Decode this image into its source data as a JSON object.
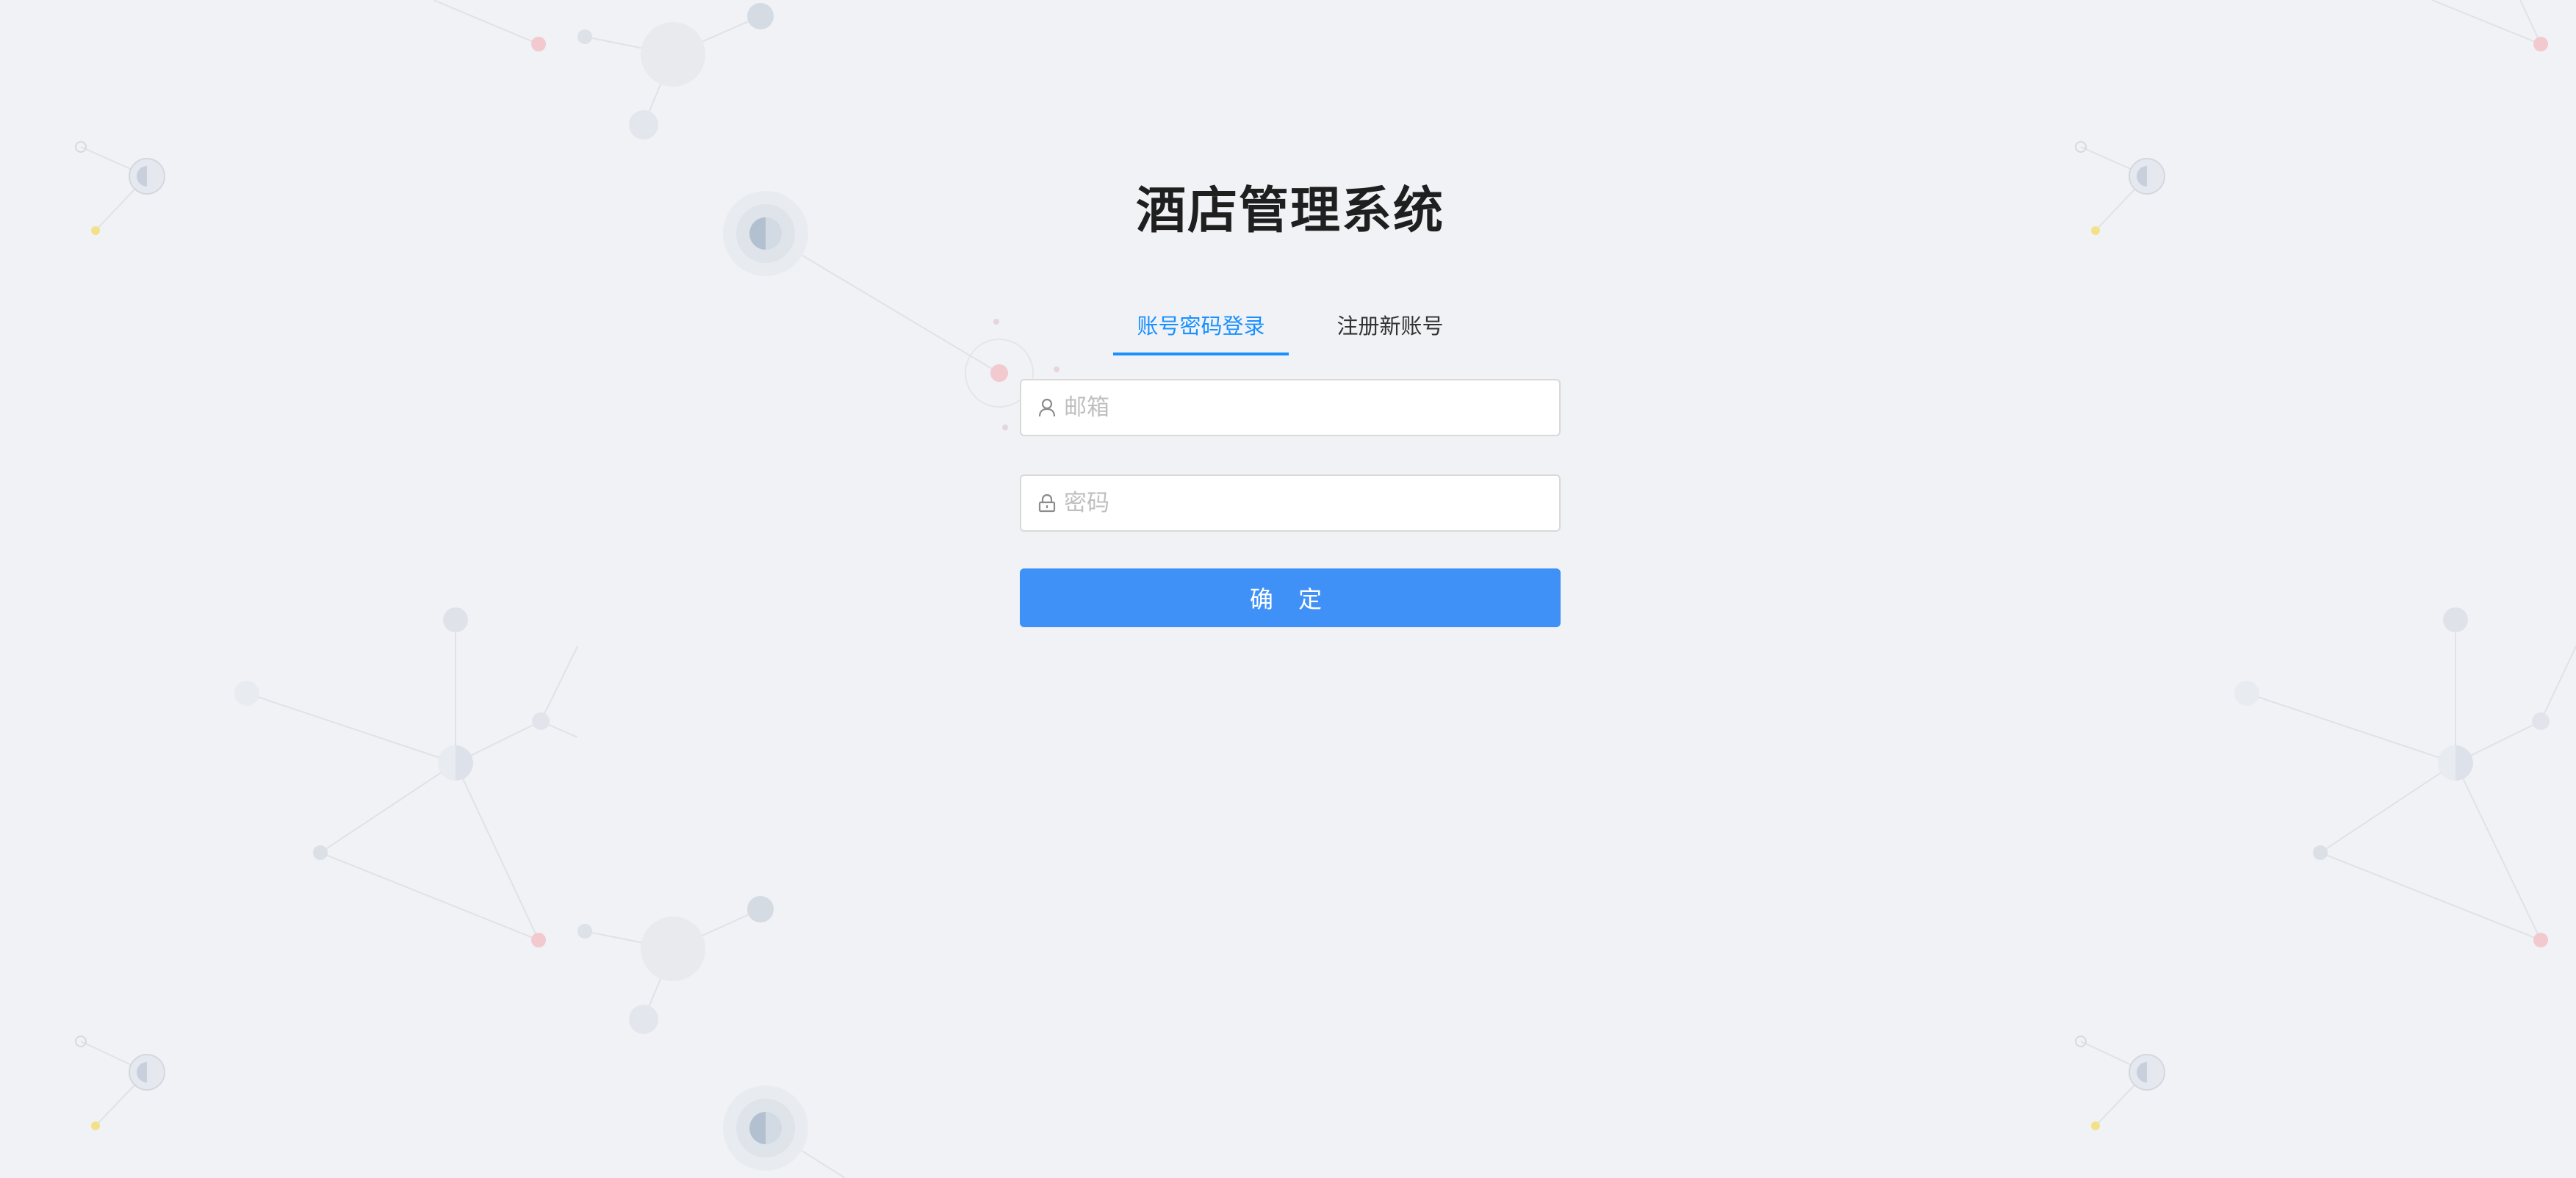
{
  "app": {
    "title": "酒店管理系统"
  },
  "tabs": [
    {
      "label": "账号密码登录",
      "active": true
    },
    {
      "label": "注册新账号",
      "active": false
    }
  ],
  "form": {
    "email": {
      "value": "",
      "placeholder": "邮箱",
      "icon": "user-icon"
    },
    "password": {
      "value": "",
      "placeholder": "密码",
      "icon": "lock-icon"
    },
    "submit_label": "确 定"
  },
  "colors": {
    "accent": "#1890ff",
    "button": "#4091f7",
    "background": "#f0f2f5"
  }
}
